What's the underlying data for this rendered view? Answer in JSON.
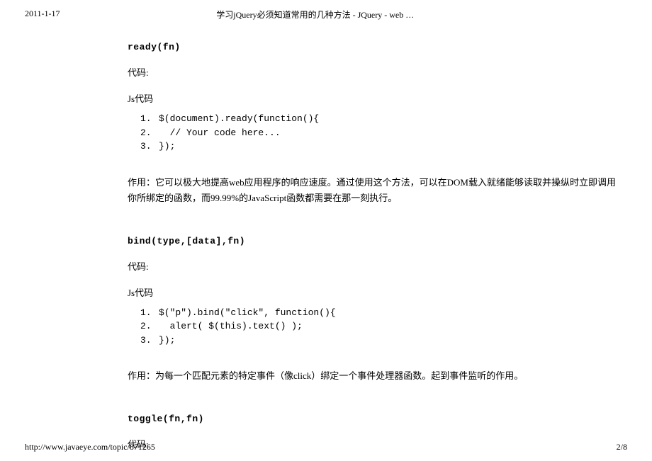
{
  "header": {
    "date": "2011-1-17",
    "title": "学习jQuery必须知道常用的几种方法 - JQuery - web …"
  },
  "sections": [
    {
      "heading": "ready(fn)",
      "code_label": "代码:",
      "js_label": "Js代码",
      "code": [
        "$(document).ready(function(){",
        "  // Your code here...",
        "});"
      ],
      "description": "作用：它可以极大地提高web应用程序的响应速度。通过使用这个方法，可以在DOM载入就绪能够读取并操纵时立即调用你所绑定的函数，而99.99%的JavaScript函数都需要在那一刻执行。"
    },
    {
      "heading": "bind(type,[data],fn)",
      "code_label": "代码:",
      "js_label": "Js代码",
      "code": [
        "$(\"p\").bind(\"click\", function(){",
        "  alert( $(this).text() );",
        "});"
      ],
      "description": "作用：为每一个匹配元素的特定事件（像click）绑定一个事件处理器函数。起到事件监听的作用。"
    },
    {
      "heading": "toggle(fn,fn)",
      "code_label": "代码:",
      "js_label": "",
      "code": [],
      "description": ""
    }
  ],
  "footer": {
    "url": "http://www.javaeye.com/topic/871265",
    "page": "2/8"
  }
}
